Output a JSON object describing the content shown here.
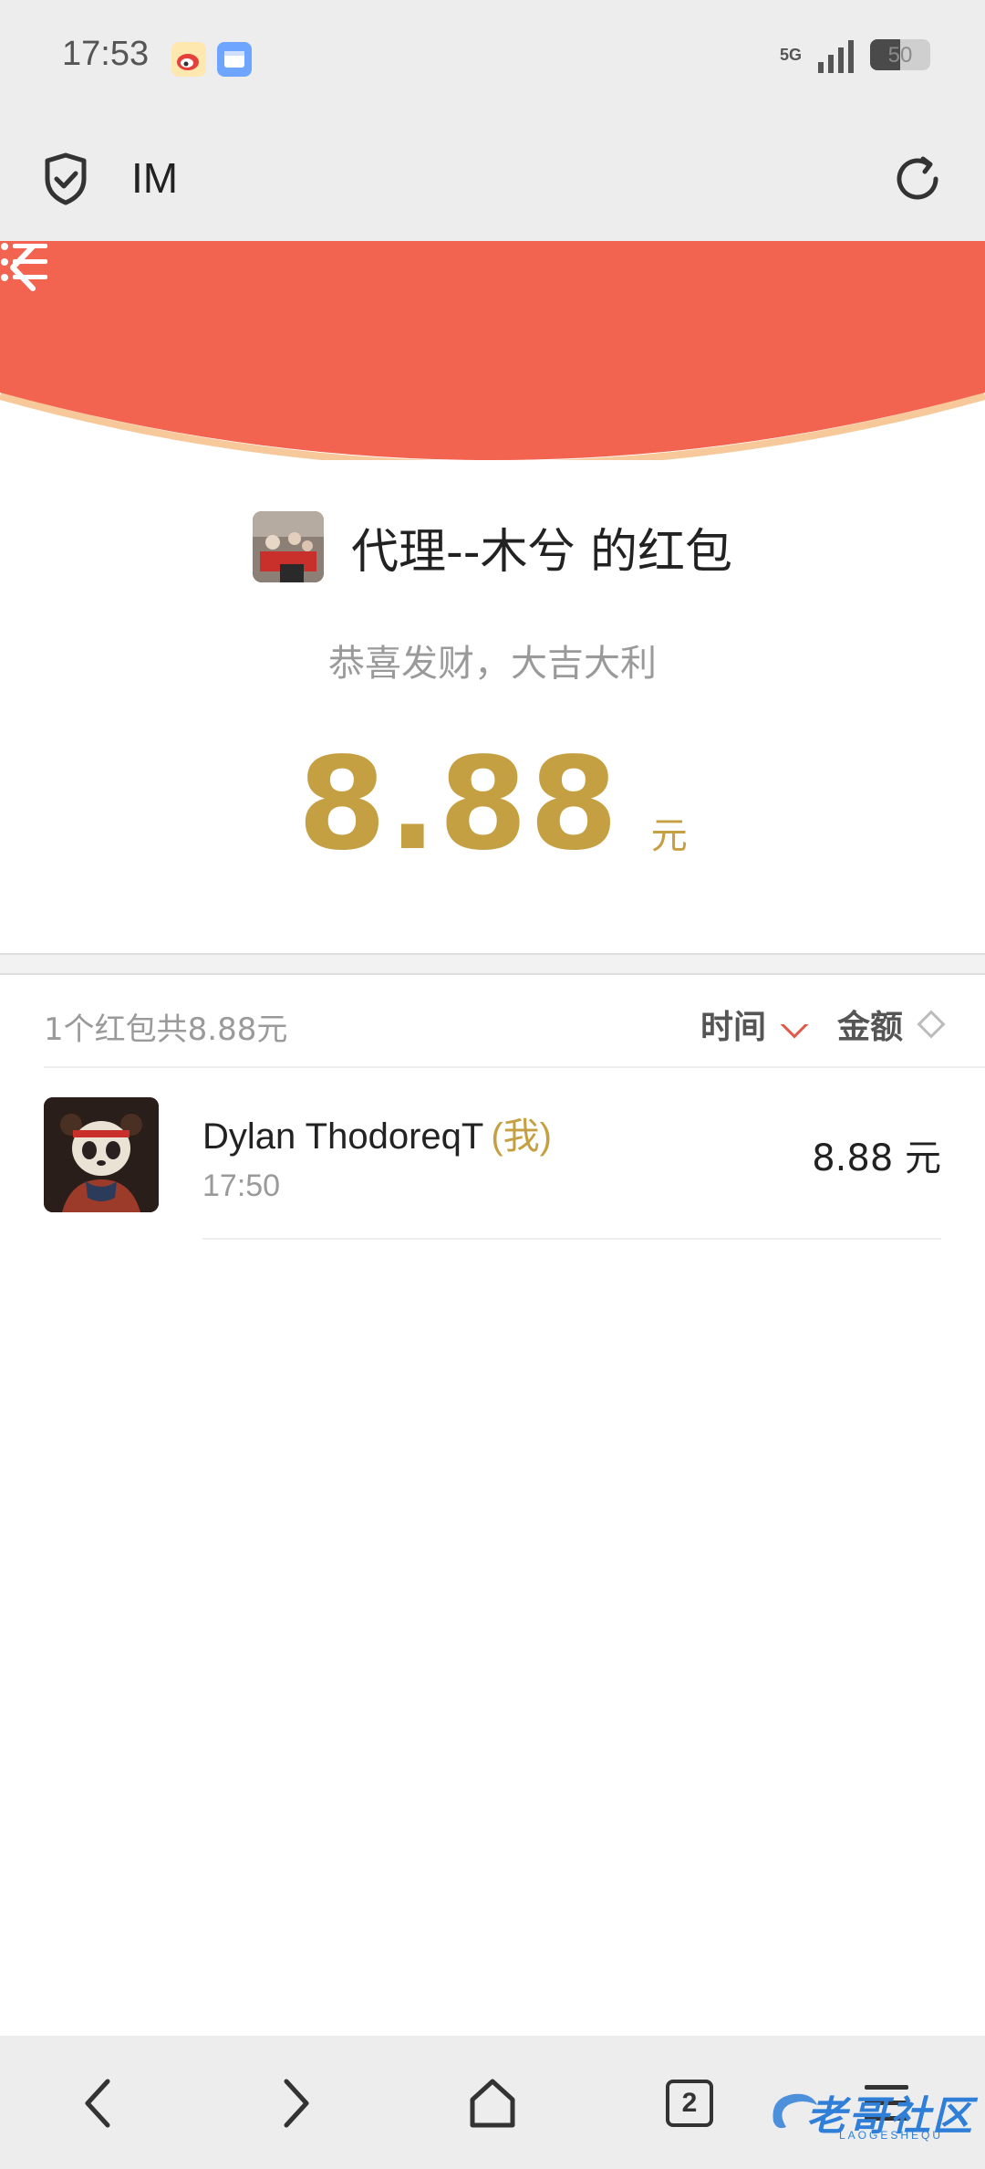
{
  "status_bar": {
    "time": "17:53",
    "network": "5G",
    "battery": "50",
    "battery_level": 0.5,
    "icons": [
      "weibo-icon",
      "app-icon",
      "signal-icon",
      "battery-icon"
    ]
  },
  "browser": {
    "title": "IM",
    "icons": [
      "shield-check-icon",
      "refresh-icon"
    ]
  },
  "header": {
    "colors": {
      "red": "#f26350",
      "accent_line": "#f7c99a"
    },
    "icons": [
      "back-arrow-icon",
      "menu-list-icon"
    ]
  },
  "packet": {
    "sender_title": "代理--木兮 的红包",
    "blessing": "恭喜发财，大吉大利",
    "amount": "8.88",
    "unit": "元",
    "amount_color": "#c5a043"
  },
  "list": {
    "summary": "1个红包共8.88元",
    "sort_time_label": "时间",
    "sort_amount_label": "金额",
    "sort_active_color": "#e05a4a",
    "records": [
      {
        "name": "Dylan ThodoreqT",
        "me_tag": "(我)",
        "time": "17:50",
        "amount": "8.88 元"
      }
    ]
  },
  "bottom_nav": {
    "tab_count": "2",
    "icons": [
      "nav-back-icon",
      "nav-forward-icon",
      "home-icon",
      "tabs-icon",
      "hamburger-menu-icon"
    ]
  },
  "watermark": {
    "text": "老哥社区",
    "sub": "LAOGESHEQU"
  }
}
